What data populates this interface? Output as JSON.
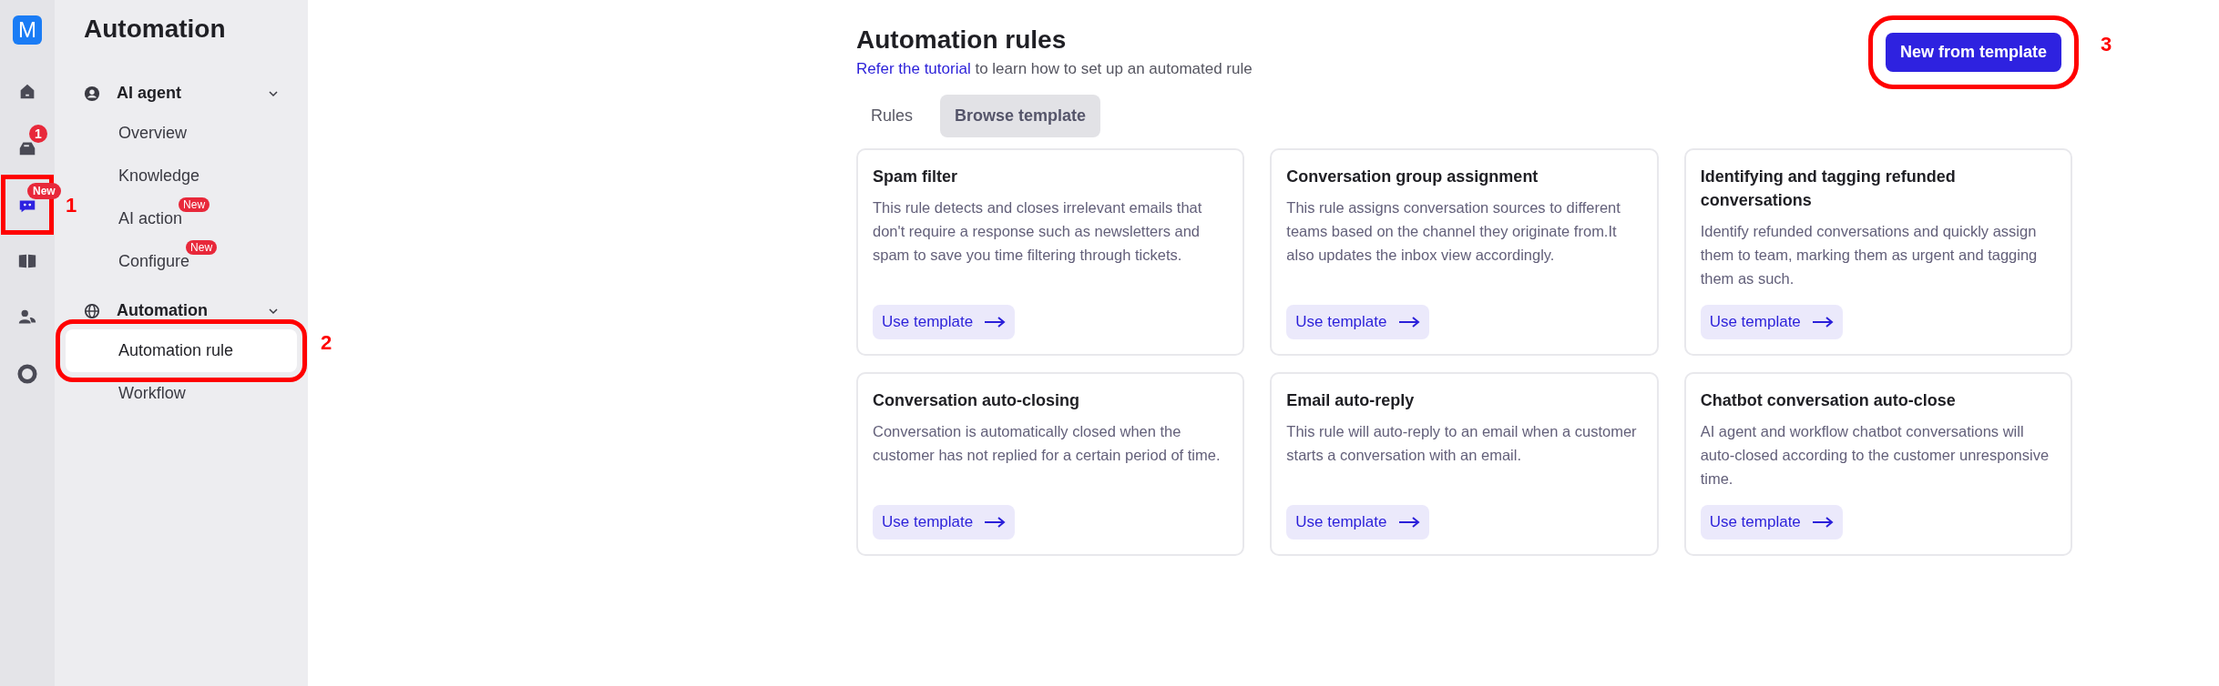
{
  "rail": {
    "logo": "M",
    "items": [
      {
        "kind": "home",
        "selected": false
      },
      {
        "kind": "inbox",
        "selected": false,
        "badge": "1"
      },
      {
        "kind": "bot",
        "selected": true,
        "badge": "New",
        "annotation": "1"
      },
      {
        "kind": "book",
        "selected": false
      },
      {
        "kind": "users",
        "selected": false
      },
      {
        "kind": "chart",
        "selected": false
      }
    ]
  },
  "sidebar": {
    "title": "Automation",
    "groups": [
      {
        "kind": "agent",
        "label": "AI agent",
        "expanded": true,
        "items": [
          {
            "label": "Overview",
            "selected": false
          },
          {
            "label": "Knowledge",
            "selected": false
          },
          {
            "label": "AI action",
            "selected": false,
            "badge": "New"
          },
          {
            "label": "Configure",
            "selected": false,
            "badge": "New"
          }
        ]
      },
      {
        "kind": "globe",
        "label": "Automation",
        "expanded": true,
        "items": [
          {
            "label": "Automation rule",
            "selected": true,
            "annotation": "2"
          },
          {
            "label": "Workflow",
            "selected": false
          }
        ]
      }
    ]
  },
  "main": {
    "title": "Automation rules",
    "subtitle_link": "Refer the tutorial",
    "subtitle_rest": " to learn how to set up an automated rule",
    "primary_button": {
      "label": "New from template",
      "annotation": "3"
    },
    "tabs": [
      {
        "label": "Rules",
        "selected": false
      },
      {
        "label": "Browse template",
        "selected": true
      }
    ],
    "cards": [
      {
        "title": "Spam filter",
        "description": "This rule detects and closes irrelevant emails that don't require a response such as newsletters and spam to save you time filtering through tickets.",
        "action": "Use template"
      },
      {
        "title": "Conversation group assignment",
        "description": "This rule assigns conversation sources to different teams based on the channel they originate from.It also updates the inbox view accordingly.",
        "action": "Use template"
      },
      {
        "title": "Identifying and tagging refunded conversations",
        "description": "Identify refunded conversations and quickly assign them to team, marking them as urgent and tagging them as such.",
        "action": "Use template"
      },
      {
        "title": "Conversation auto-closing",
        "description": "Conversation is automatically closed when the customer has not replied for a certain period of time.",
        "action": "Use template"
      },
      {
        "title": "Email auto-reply",
        "description": "This rule will auto-reply to an email when a customer starts a conversation with an email.",
        "action": "Use template"
      },
      {
        "title": "Chatbot conversation auto-close",
        "description": "AI agent and workflow chatbot conversations will auto-closed according to the customer unresponsive time.",
        "action": "Use template"
      }
    ]
  }
}
